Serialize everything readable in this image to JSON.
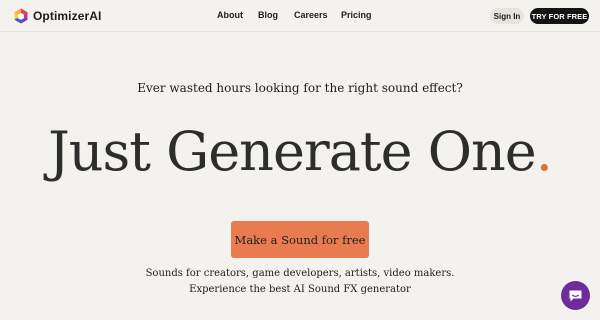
{
  "header": {
    "brand_name": "OptimizerAI",
    "logo_icon": "optimizerai-logo-icon",
    "nav_links": [
      "About",
      "Blog",
      "Careers",
      "Pricing"
    ],
    "signin_label": "Sign In",
    "try_label": "TRY FOR FREE"
  },
  "hero": {
    "subheading": "Ever wasted hours looking for the right sound effect?",
    "headline": "Just Generate One",
    "headline_dot": ".",
    "cta_label": "Make a Sound for free",
    "description_line1": "Sounds for creators, game developers, artists, video makers.",
    "description_line2": "Experience the best AI Sound FX generator"
  },
  "chat_widget": {
    "icon": "chat-bubble-icon"
  },
  "colors": {
    "background": "#f4f2ee",
    "accent": "#e87b4f",
    "dot_accent": "#e1703f",
    "dark_button": "#141414",
    "chat_purple": "#6e2b9c"
  }
}
